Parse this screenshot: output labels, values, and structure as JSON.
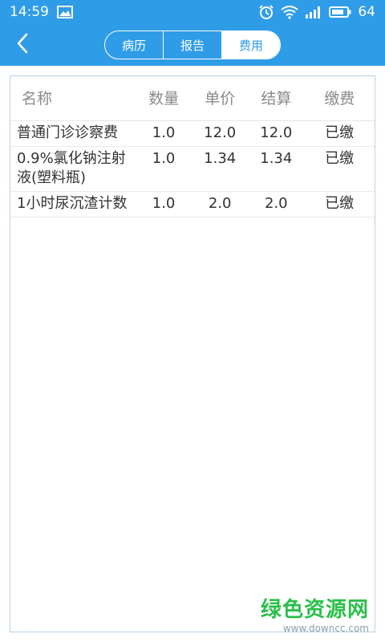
{
  "status": {
    "time": "14:59",
    "battery": "64",
    "icons": [
      "image-icon",
      "alarm-icon",
      "wifi-icon",
      "signal-icon",
      "battery-icon"
    ]
  },
  "nav": {
    "back_icon": "chevron-left-icon",
    "tabs": [
      {
        "label": "病历",
        "active": false
      },
      {
        "label": "报告",
        "active": false
      },
      {
        "label": "费用",
        "active": true
      }
    ]
  },
  "table": {
    "headers": [
      "名称",
      "数量",
      "单价",
      "结算",
      "缴费"
    ],
    "rows": [
      {
        "name": "普通门诊诊察费",
        "qty": "1.0",
        "price": "12.0",
        "total": "12.0",
        "status": "已缴"
      },
      {
        "name": "0.9%氯化钠注射液(塑料瓶)",
        "qty": "1.0",
        "price": "1.34",
        "total": "1.34",
        "status": "已缴"
      },
      {
        "name": "1小时尿沉渣计数",
        "qty": "1.0",
        "price": "2.0",
        "total": "2.0",
        "status": "已缴"
      }
    ]
  },
  "watermark": {
    "main": "绿色资源网",
    "sub": "www.downcc.com"
  },
  "colors": {
    "primary": "#2f9ce8",
    "watermark": "#2bbf4a"
  }
}
